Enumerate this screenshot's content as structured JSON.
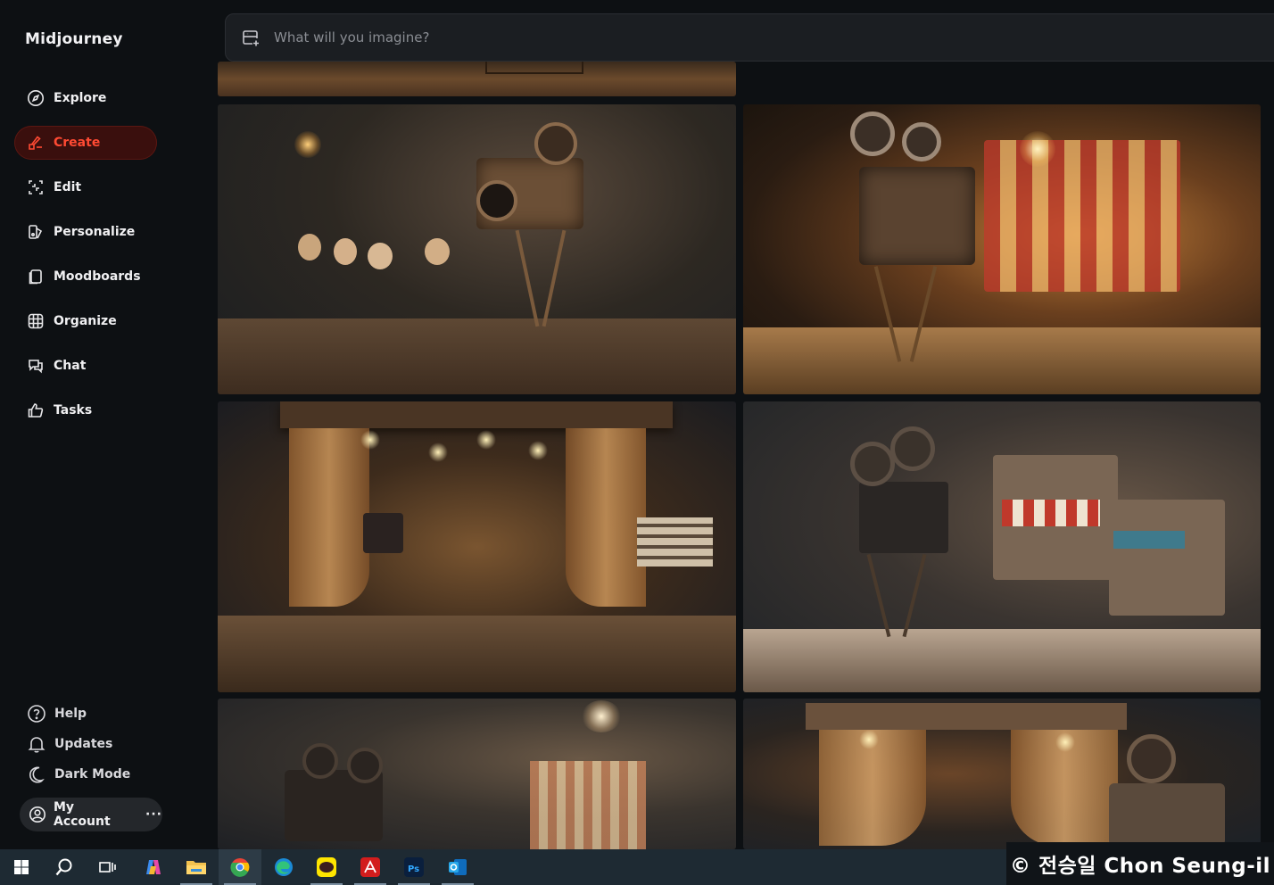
{
  "app": {
    "name": "Midjourney"
  },
  "nav": {
    "items": [
      {
        "label": "Explore",
        "icon": "compass-icon"
      },
      {
        "label": "Create",
        "icon": "brush-icon",
        "active": true
      },
      {
        "label": "Edit",
        "icon": "edit-frame-icon"
      },
      {
        "label": "Personalize",
        "icon": "personalize-icon"
      },
      {
        "label": "Moodboards",
        "icon": "moodboard-icon"
      },
      {
        "label": "Organize",
        "icon": "grid-icon"
      },
      {
        "label": "Chat",
        "icon": "chat-icon"
      },
      {
        "label": "Tasks",
        "icon": "thumbs-up-icon"
      }
    ]
  },
  "footer": {
    "help": "Help",
    "updates": "Updates",
    "dark_mode": "Dark Mode",
    "account": "My Account",
    "account_more": "···"
  },
  "prompt": {
    "placeholder": "What will you imagine?"
  },
  "gallery": {
    "images": [
      {
        "subject": "miniature wooden film set - partial top"
      },
      {
        "subject": "wooden figures with vintage movie camera"
      },
      {
        "subject": "vintage movie camera on tripod in front of circus tent"
      },
      {
        "subject": "miniature theater stage with figures and clapperboard"
      },
      {
        "subject": "movie camera on tripod in miniature western town"
      },
      {
        "subject": "movie camera with striped backdrop"
      },
      {
        "subject": "miniature theater curtain with camera"
      }
    ]
  },
  "taskbar": {
    "apps": [
      "windows-start-icon",
      "search-icon",
      "task-view-icon",
      "copilot-icon",
      "file-explorer-icon",
      "chrome-icon",
      "edge-icon",
      "kakaotalk-icon",
      "acrobat-icon",
      "photoshop-icon",
      "outlook-icon"
    ]
  },
  "watermark": "© 전승일 Chon Seung-il",
  "colors": {
    "accent": "#ff4a33",
    "sidebar_bg": "#0d1013",
    "taskbar_bg": "#1e2a33"
  }
}
